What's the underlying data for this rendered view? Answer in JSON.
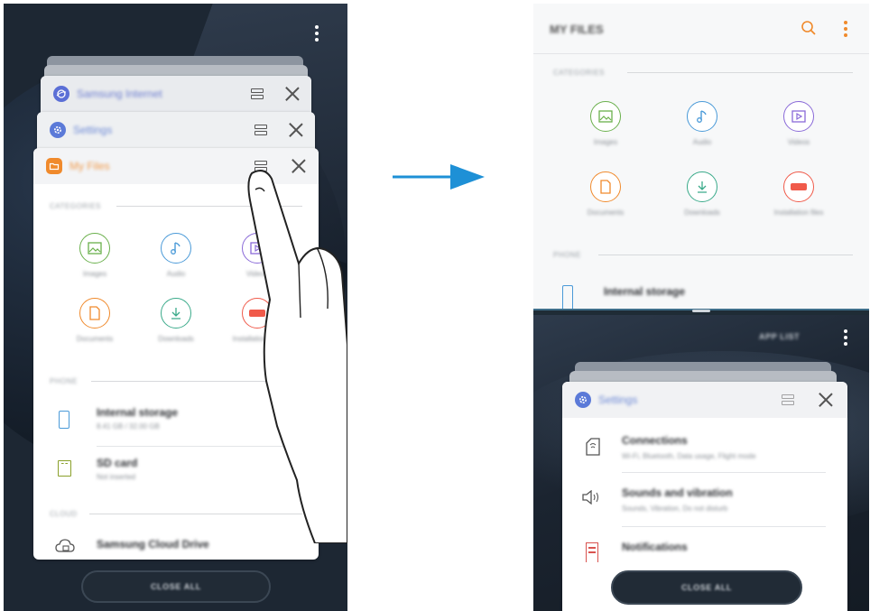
{
  "left_screen": {
    "stacked_apps": [
      {
        "name": "Samsung Internet",
        "color": "#5b6fd6",
        "text_color": "#6e7fd0"
      },
      {
        "name": "Settings",
        "color": "#5b7ad8",
        "text_color": "#6e8ad6"
      },
      {
        "name": "My Files",
        "color": "#f08a2c",
        "text_color": "#f09a4a"
      }
    ],
    "my_files": {
      "section_categories": "CATEGORIES",
      "categories": [
        {
          "label": "Images",
          "icon": "image-icon",
          "color": "#6ab04c"
        },
        {
          "label": "Audio",
          "icon": "music-note-icon",
          "color": "#4a9ad8"
        },
        {
          "label": "Videos",
          "icon": "video-icon",
          "color": "#8a6ad8"
        },
        {
          "label": "Documents",
          "icon": "document-icon",
          "color": "#f08a2c"
        },
        {
          "label": "Downloads",
          "icon": "download-icon",
          "color": "#3aaa8a"
        },
        {
          "label": "Installation files",
          "icon": "apk-icon",
          "color": "#f05a4a"
        }
      ],
      "section_phone": "PHONE",
      "storage": [
        {
          "title": "Internal storage",
          "subtitle": "8.41 GB / 32.00 GB",
          "icon": "phone-icon"
        },
        {
          "title": "SD card",
          "subtitle": "Not inserted",
          "icon": "sd-card-icon"
        }
      ],
      "section_cloud": "CLOUD",
      "cloud": {
        "title": "Samsung Cloud Drive",
        "icon": "cloud-icon"
      }
    },
    "close_all": "CLOSE ALL"
  },
  "right_screen": {
    "top_app": {
      "title": "MY FILES",
      "section_categories": "CATEGORIES",
      "categories": [
        {
          "label": "Images",
          "icon": "image-icon",
          "color": "#6ab04c"
        },
        {
          "label": "Audio",
          "icon": "music-note-icon",
          "color": "#4a9ad8"
        },
        {
          "label": "Videos",
          "icon": "video-icon",
          "color": "#8a6ad8"
        },
        {
          "label": "Documents",
          "icon": "document-icon",
          "color": "#f08a2c"
        },
        {
          "label": "Downloads",
          "icon": "download-icon",
          "color": "#3aaa8a"
        },
        {
          "label": "Installation files",
          "icon": "apk-icon",
          "color": "#f05a4a"
        }
      ],
      "section_phone": "PHONE",
      "storage_title": "Internal storage"
    },
    "bottom": {
      "app_list": "APP LIST",
      "settings_card": {
        "name": "Settings",
        "rows": [
          {
            "title": "Connections",
            "subtitle": "Wi-Fi, Bluetooth, Data usage, Flight mode",
            "icon": "connections-icon"
          },
          {
            "title": "Sounds and vibration",
            "subtitle": "Sounds, Vibration, Do not disturb",
            "icon": "speaker-icon"
          },
          {
            "title": "Notifications",
            "subtitle": "",
            "icon": "notifications-icon"
          }
        ]
      },
      "close_all": "CLOSE ALL"
    }
  },
  "colors": {
    "accent_arrow": "#1e90d6",
    "dark_bg": "#1d2733"
  }
}
